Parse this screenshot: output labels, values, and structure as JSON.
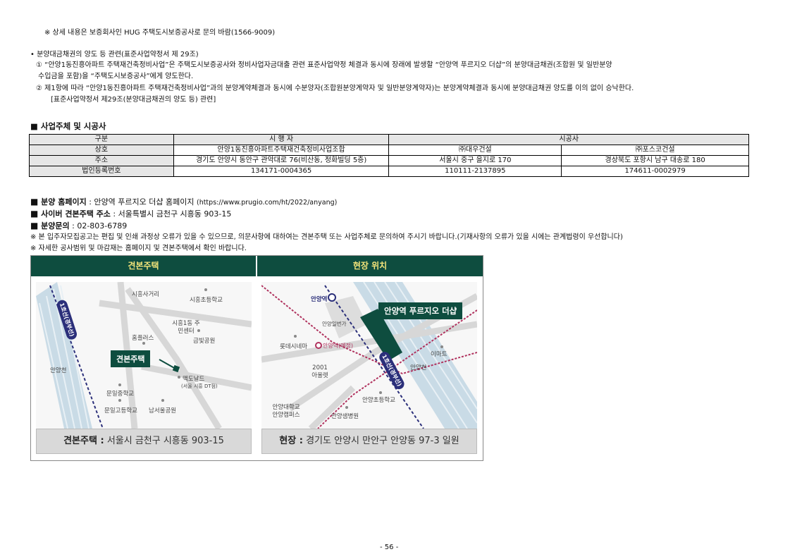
{
  "notes": {
    "hug_note": "※ 상세 내용은 보증회사인 HUG 주택도시보증공사로 문의 바람(1566-9009)",
    "transfer_title": "• 분양대금채권의 양도 등 관련(표준사업약정서 제 29조)",
    "transfer_1a": "① “안양1동진흥아파트 주택재건축정비사업”은 주택도시보증공사와 정비사업자금대출 관련 표준사업약정 체결과 동시에 장래에 발생할 “안양역 푸르지오 더샵”의 분양대금채권(조합원 및 일반분양",
    "transfer_1b": "수입금을 포함)을 “주택도시보증공사”에게 양도한다.",
    "transfer_2a": "② 제1항에 따라 “안양1동진흥아파트 주택재건축정비사업”과의 분양계약체결과 동시에 수분양자(조합원분양계약자 및 일반분양계약자)는 분양계약체결과 동시에 분양대금채권 양도를 이의 없이 승낙한다.",
    "transfer_2b": "[표준사업약정서 제29조(분양대금채권의 양도 등) 관련]"
  },
  "business": {
    "heading": "■ 사업주체 및 시공사",
    "header_row": [
      "구분",
      "시 행 자",
      "시공사"
    ],
    "rows": [
      [
        "상호",
        "안양1동진흥아파트주택재건축정비사업조합",
        "㈜대우건설",
        "㈜포스코건설"
      ],
      [
        "주소",
        "경기도 안양시 동안구 관악대로 76(비산동, 정화빌딩 5층)",
        "서울시 중구 을지로 170",
        "경상북도 포항시 남구 대송로 180"
      ],
      [
        "법인등록번호",
        "134171-0004365",
        "110111-2137895",
        "174611-0002979"
      ]
    ]
  },
  "contact": {
    "homepage_label": "분양 홈페이지",
    "homepage_value": ": 안양역 푸르지오 더샵 홈페이지",
    "homepage_url": "(https://www.prugio.com/ht/2022/anyang)",
    "cyber_label": "사이버 견본주택 주소",
    "cyber_value": ": 서울특별시 금천구 시흥동 903-15",
    "inquiry_label": "분양문의",
    "inquiry_value": ": 02-803-6789",
    "note1": "※ 본 입주자모집공고는 편집 및 인쇄 과정상 오류가 있을 수 있으므로, 의문사항에 대하여는 견본주택 또는 사업주체로 문의하여 주시기 바랍니다.(기재사항의 오류가 있을 시에는 관계법령이 우선합니다)",
    "note2": "※ 자세한 공사범위 및 마감재는 홈페이지 및 견본주택에서 확인 바랍니다."
  },
  "map_left": {
    "title": "견본주택",
    "tag": "견본주택",
    "line_label": "1호선(경부선)",
    "places": [
      "시흥사거리",
      "시흥초등학교",
      "시흥1동 주민센터",
      "홈플러스",
      "금빛공원",
      "안양천",
      "맥도날드",
      "(서울 시흥 DT점)",
      "문일중학교",
      "문일고등학교",
      "남서울공원"
    ],
    "footer_bold": "견본주택 :",
    "footer_text": "서울시 금천구 시흥동 903-15"
  },
  "map_right": {
    "title": "현장 위치",
    "tag": "안양역 푸르지오 더샵",
    "line_label": "1호선(경부선)",
    "places": [
      "안양역",
      "안양일번가",
      "롯데시네마",
      "안양역(예정)",
      "2001 아울렛",
      "이마트",
      "안양천",
      "안양초등학교",
      "안양대학교 안양캠퍼스",
      "안양샘병원"
    ],
    "footer_bold": "현장 :",
    "footer_text": "경기도 안양시 만안구 안양동 97-3 일원"
  },
  "page_number": "- 56 -",
  "colors": {
    "map_header": "#0e4d3f",
    "map_header_text": "#f3e47a",
    "route": "#b0325e",
    "rail": "#2b2f7a"
  }
}
